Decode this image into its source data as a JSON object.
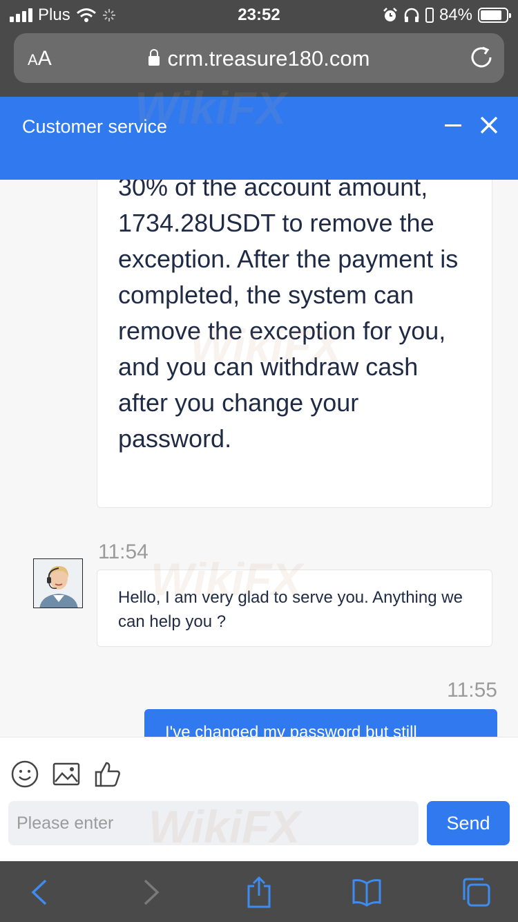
{
  "status_bar": {
    "carrier": "Plus",
    "time": "23:52",
    "battery": "84%",
    "battery_level": 0.84
  },
  "browser": {
    "text_size_label_small": "A",
    "text_size_label_large": "A",
    "url": "crm.treasure180.com"
  },
  "chat": {
    "title": "Customer service"
  },
  "messages": [
    {
      "direction": "incoming",
      "text": "30% of the account amount, 1734.28USDT to remove the exception. After the payment is completed, the system can remove the exception for you, and you can withdraw cash after you change your password."
    },
    {
      "direction": "incoming",
      "time": "11:54",
      "text": "Hello, I am very glad to serve you. Anything we can help you ?"
    },
    {
      "direction": "outgoing",
      "time": "11:55",
      "text": "I've changed my password but still"
    }
  ],
  "composer": {
    "placeholder": "Please enter",
    "send_label": "Send",
    "tools": [
      "emoji-icon",
      "image-icon",
      "thumbs-up-icon"
    ]
  },
  "watermark": "WikiFX",
  "colors": {
    "accent": "#3079ef",
    "browser_chrome": "#4a4a4a",
    "chat_background": "#f7f7f7"
  }
}
